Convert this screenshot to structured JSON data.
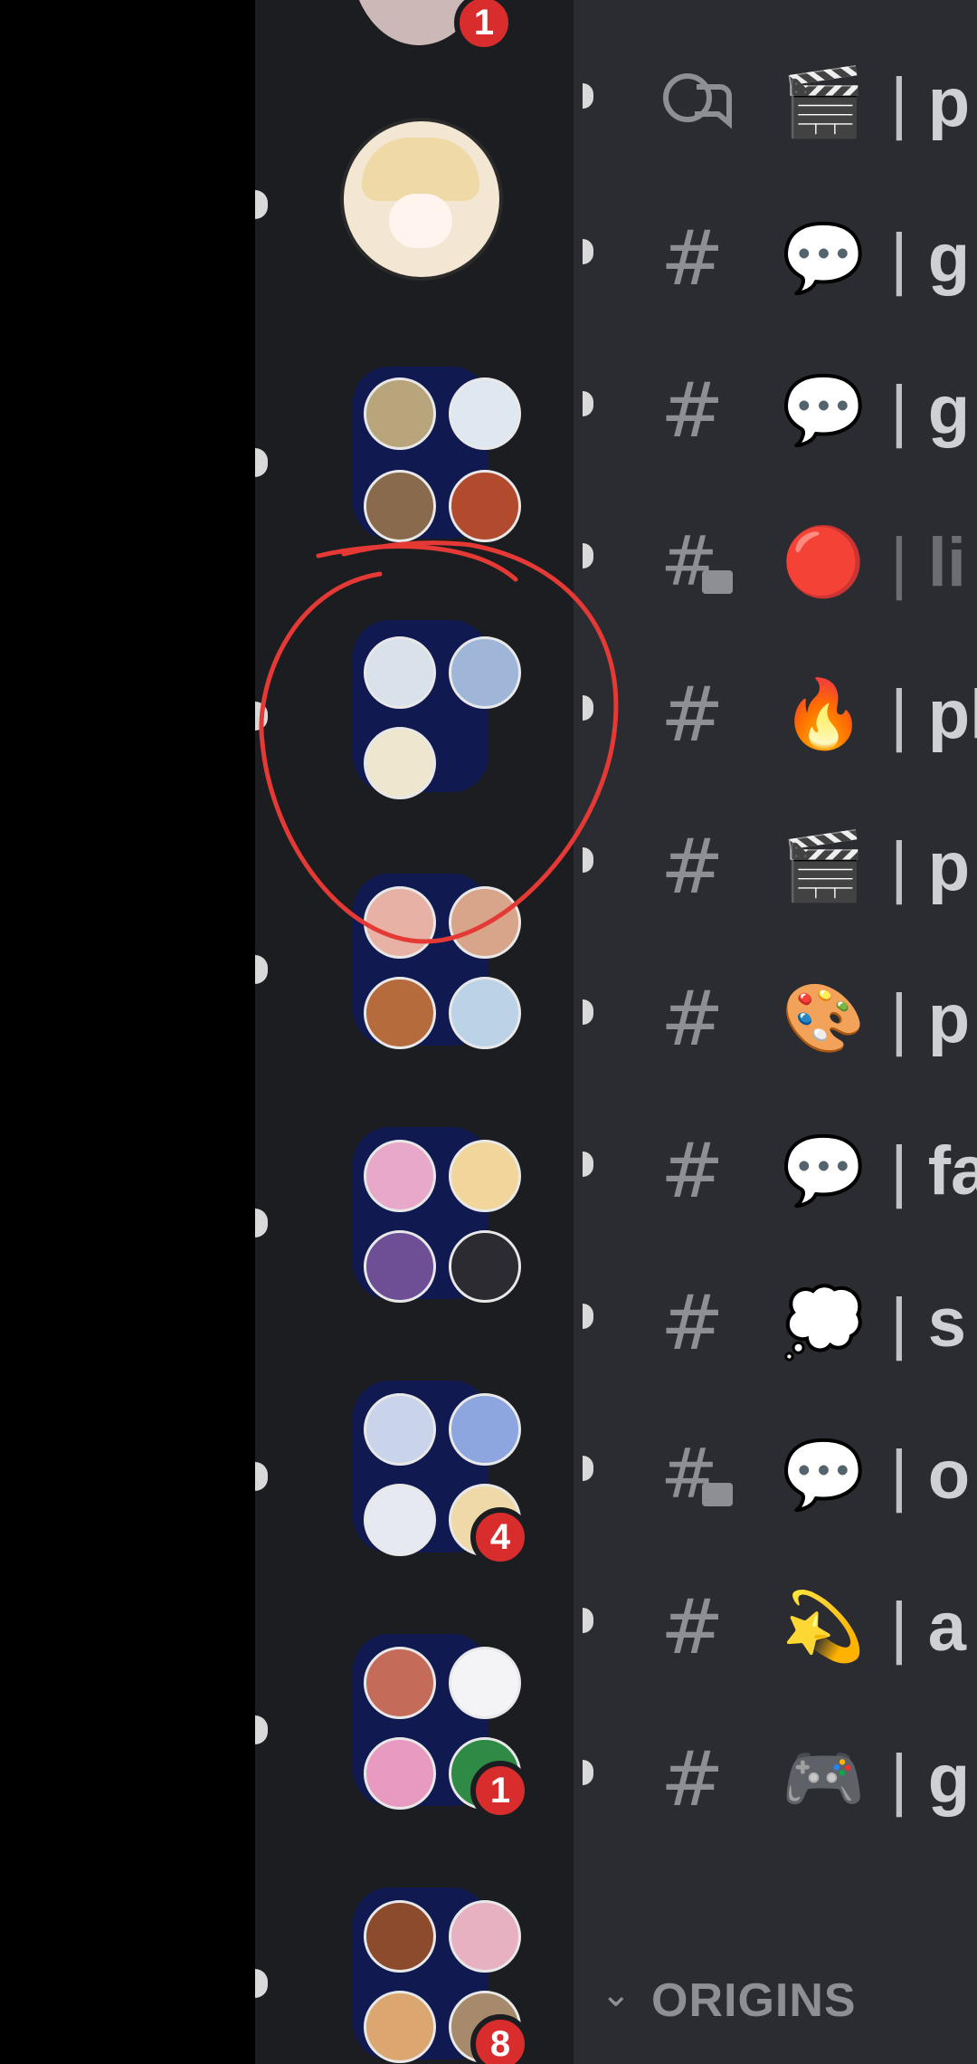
{
  "guilds": {
    "top_badge": "1",
    "folder_badges": {
      "folder_6": "4",
      "folder_7": "1",
      "folder_8": "8"
    }
  },
  "channels": [
    {
      "type": "forum-icon",
      "emoji": "🎬",
      "name": "p"
    },
    {
      "type": "hash-icon",
      "emoji": "💬",
      "name": "g"
    },
    {
      "type": "hash-icon",
      "emoji": "💬",
      "name": "g"
    },
    {
      "type": "thread-hash-icon",
      "emoji": "🔴",
      "name": "li"
    },
    {
      "type": "hash-icon",
      "emoji": "🔥",
      "name": "pl"
    },
    {
      "type": "hash-icon",
      "emoji": "🎬",
      "name": "p"
    },
    {
      "type": "hash-icon",
      "emoji": "🎨",
      "name": "p"
    },
    {
      "type": "hash-icon",
      "emoji": "💬",
      "name": "fa"
    },
    {
      "type": "hash-icon",
      "emoji": "💭",
      "name": "s"
    },
    {
      "type": "thread-hash-icon",
      "emoji": "💬",
      "name": "o"
    },
    {
      "type": "hash-icon",
      "emoji": "💫",
      "name": "a"
    },
    {
      "type": "hash-icon",
      "emoji": "🎮",
      "name": "g"
    }
  ],
  "category": {
    "label": "ORIGINS"
  },
  "colors": {
    "annotation": "#e53935",
    "badge": "#d92d2d",
    "folder": "#0f1a55"
  }
}
